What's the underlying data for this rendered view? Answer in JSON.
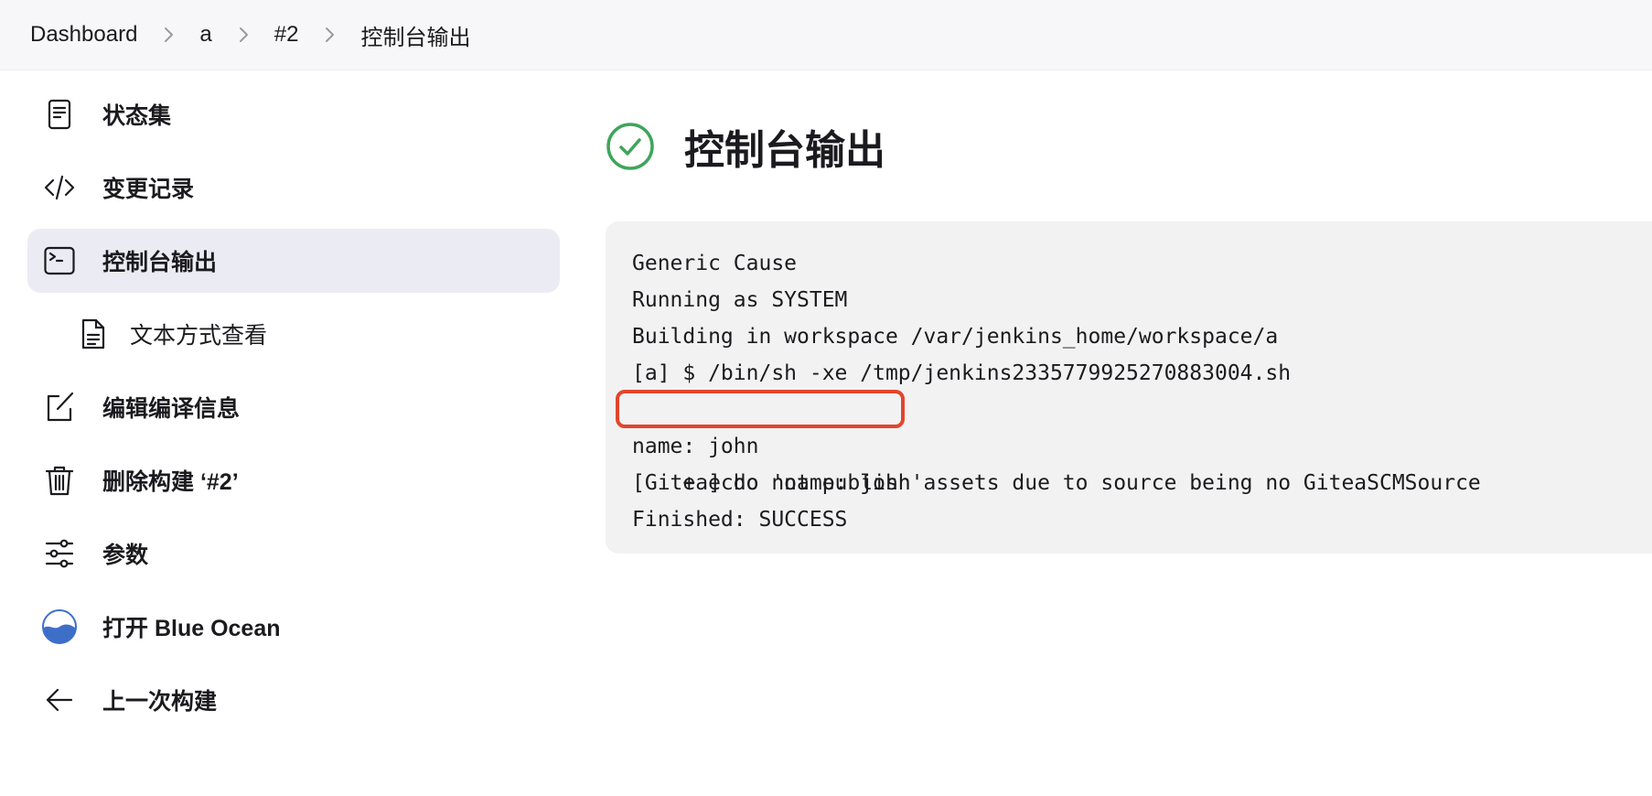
{
  "breadcrumb": [
    "Dashboard",
    "a",
    "#2",
    "控制台输出"
  ],
  "sidebar": {
    "items": [
      {
        "label": "状态集",
        "icon": "document-icon"
      },
      {
        "label": "变更记录",
        "icon": "code-icon"
      },
      {
        "label": "控制台输出",
        "icon": "terminal-icon",
        "active": true
      },
      {
        "label": "文本方式查看",
        "icon": "file-text-icon",
        "sub": true
      },
      {
        "label": "编辑编译信息",
        "icon": "edit-icon"
      },
      {
        "label": "删除构建 ‘#2’",
        "icon": "trash-icon"
      },
      {
        "label": "参数",
        "icon": "sliders-icon"
      },
      {
        "label": "打开 Blue Ocean",
        "icon": "blue-ocean-icon"
      },
      {
        "label": "上一次构建",
        "icon": "arrow-left-icon"
      }
    ]
  },
  "main": {
    "title": "控制台输出",
    "status_icon": "success-check-icon",
    "console": [
      "Generic Cause",
      "Running as SYSTEM",
      "Building in workspace /var/jenkins_home/workspace/a",
      "[a] $ /bin/sh -xe /tmp/jenkins2335779925270883004.sh",
      "+ echo 'name: john'",
      "name: john",
      "[Gitea] do not publish assets due to source being no GiteaSCMSource",
      "Finished: SUCCESS"
    ],
    "highlighted_line": 4
  },
  "colors": {
    "success": "#3fa55b",
    "highlight": "#e2452c",
    "active_bg": "#ebebf3",
    "console_bg": "#f2f2f2"
  }
}
